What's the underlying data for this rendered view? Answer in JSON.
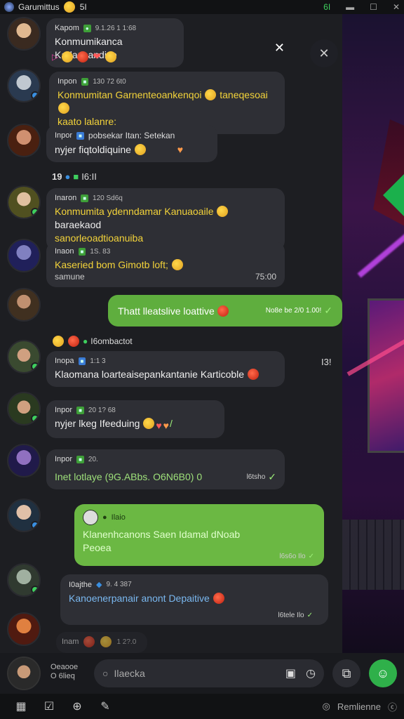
{
  "status_bar": {
    "app_name": "Garumittus",
    "app_suffix": "5I",
    "right_items": [
      "6I",
      "▬",
      "☐",
      "✕"
    ]
  },
  "messages": [
    {
      "author": "Kapom",
      "tag": "",
      "time": "9.1.26 1 1:68",
      "text": "Konmumikanca Karlancandiye",
      "style": "white"
    },
    {
      "author": "Inpon",
      "tag": "",
      "time": "130 72 6t0",
      "text": "Konmumitan Garnenteoankenqoi",
      "text2": "taneqesoai",
      "text3": "kaato lalanre;",
      "style": "yellow"
    },
    {
      "author": "Inpor",
      "tag": "",
      "time": "",
      "text_head": "pobsekar Itan: Setekan",
      "text": "nyjer fiqtoldiquine",
      "style": "white"
    },
    {
      "author": "Inaron",
      "tag": "",
      "time": "120 Sd6q",
      "text": "Konmumita ydenndamar Kanuaoaile",
      "text2": "baraekaod",
      "text3": "sanorleoadtioanuiba",
      "style": "yellow"
    },
    {
      "author": "Inaon",
      "tag": "",
      "time": "1S. 83",
      "text": "Kaseried bom Gimotb loft;",
      "text3": "samune",
      "time2": "75:00",
      "style": "yellow"
    },
    {
      "author": "",
      "text": "Thatt lleatslive loattive",
      "time": "No8e be 2/0 1.00!",
      "style": "green"
    },
    {
      "author": "Inopa",
      "tag": "",
      "time": "1:1 3",
      "text": "Klaomana loarteaisepankantanie Karticoble",
      "style": "white",
      "side": "I3!"
    },
    {
      "author": "Inpor",
      "tag": "",
      "time": "20 1? 68",
      "text": "nyjer lkeg Ifeeduing",
      "style": "white"
    },
    {
      "author": "Inpor",
      "tag": "",
      "time": "20.",
      "text": "Inet lotlaye (9G.ABbs. O6N6B0) 0",
      "time2": "l6tsho",
      "style": "green-text"
    },
    {
      "author": "Ilaio",
      "text": "Klanenhcanons Saen Idamal dNoab",
      "text3": "Peoea",
      "time": "l6s6o Ilo",
      "style": "green-reply"
    },
    {
      "author": "I0ajthe",
      "tag": "",
      "time": "9. 4 387",
      "text": "Kanoenerpanair anont Depaitive",
      "time2": "l6tele Ilo",
      "style": "blue-text"
    },
    {
      "author": "Inam",
      "time": "1 2?.0",
      "style": "faded"
    }
  ],
  "date_row": "19",
  "date_row_extra": "I6:II",
  "reaction_row_label": "I6ombactot",
  "input": {
    "side_label_1": "Oeaooe",
    "side_label_2": "O 6lieq",
    "placeholder": "Ilaecka"
  },
  "navbar": {
    "items": [
      "▦",
      "☑",
      "⊕",
      "✎"
    ],
    "right_label": "Remlienne"
  }
}
